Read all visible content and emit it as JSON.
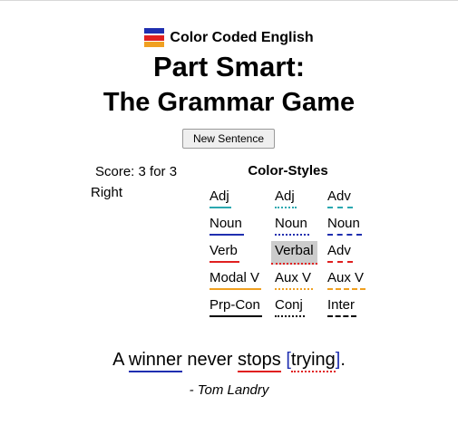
{
  "brand": {
    "title": "Color Coded English",
    "flag_colors": [
      "#1f2fb0",
      "#e02020",
      "#f0a020"
    ]
  },
  "title_line1": "Part Smart:",
  "title_line2": "The Grammar Game",
  "new_sentence_button": "New Sentence",
  "score": {
    "line1": "Score: 3 for 3",
    "line2": "Right"
  },
  "color_styles": {
    "title": "Color-Styles",
    "selected": "Verbal",
    "items": [
      {
        "label": "Adj",
        "color": "#2aa8b0",
        "style": "solid"
      },
      {
        "label": "Adj",
        "color": "#2aa8b0",
        "style": "dotted"
      },
      {
        "label": "Adv",
        "color": "#2aa8b0",
        "style": "dashed"
      },
      {
        "label": "Noun",
        "color": "#1f2fb0",
        "style": "solid"
      },
      {
        "label": "Noun",
        "color": "#1f2fb0",
        "style": "dotted"
      },
      {
        "label": "Noun",
        "color": "#1f2fb0",
        "style": "dashed"
      },
      {
        "label": "Verb",
        "color": "#e02020",
        "style": "solid"
      },
      {
        "label": "Verbal",
        "color": "#e02020",
        "style": "dotted"
      },
      {
        "label": "Adv",
        "color": "#e02020",
        "style": "dashed"
      },
      {
        "label": "Modal V",
        "color": "#f0a020",
        "style": "solid"
      },
      {
        "label": "Aux V",
        "color": "#f0a020",
        "style": "dotted"
      },
      {
        "label": "Aux V",
        "color": "#f0a020",
        "style": "dashed"
      },
      {
        "label": "Prp-Con",
        "color": "#000000",
        "style": "solid"
      },
      {
        "label": "Conj",
        "color": "#000000",
        "style": "dotted"
      },
      {
        "label": "Inter",
        "color": "#000000",
        "style": "dashed"
      }
    ]
  },
  "sentence": {
    "parts": [
      {
        "text": "A ",
        "color": null,
        "style": null
      },
      {
        "text": "winner",
        "color": "#1f2fb0",
        "style": "solid"
      },
      {
        "text": " never ",
        "color": null,
        "style": null
      },
      {
        "text": "stops",
        "color": "#e02020",
        "style": "solid"
      },
      {
        "text": " ",
        "color": null,
        "style": null
      },
      {
        "text": "[",
        "color": "#1f2fb0",
        "style": null
      },
      {
        "text": "trying",
        "color": "#e02020",
        "style": "dotted"
      },
      {
        "text": "]",
        "color": "#1f2fb0",
        "style": null
      },
      {
        "text": ".",
        "color": null,
        "style": null
      }
    ],
    "author": "- Tom Landry"
  }
}
